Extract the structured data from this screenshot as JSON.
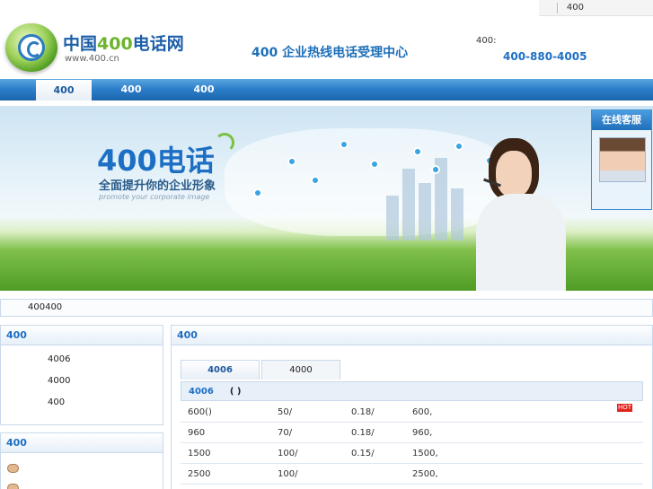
{
  "top_links": [
    "",
    "400",
    "",
    "",
    ""
  ],
  "header": {
    "logo_prefix": "中国",
    "logo_number": "400",
    "logo_suffix": "电话网",
    "logo_url": "www.400.cn",
    "slogan": "400 企业热线电话受理中心",
    "hotline_label": "400:",
    "hotline_number": "400-880-4005"
  },
  "nav": {
    "items": [
      "400",
      "400",
      "400"
    ],
    "active_index": 0
  },
  "banner": {
    "headline_number": "400",
    "headline_text": "电话",
    "sub": "全面提升你的企业形象",
    "en": "promote your corporate image"
  },
  "service": {
    "title": "在线客服"
  },
  "notice": "400400",
  "left_panel_1": {
    "title": "400",
    "items": [
      "4006",
      "4000",
      "400"
    ]
  },
  "left_panel_2": {
    "title": "400",
    "items": [
      "",
      ""
    ]
  },
  "main_panel": {
    "title": "400",
    "tabs": [
      "4006",
      "4000"
    ],
    "active_tab": 0,
    "table_head": "4006",
    "table_head_paren": "( )",
    "rows": [
      {
        "plan_num": "600",
        "plan_tag": "",
        "fee": "50/",
        "rate": "0.18/",
        "desc": "600,",
        "action": "",
        "hot": "HOT"
      },
      {
        "plan_num": "960",
        "plan_tag": "",
        "fee": "70/",
        "rate": "0.18/",
        "desc": "960,",
        "action": "",
        "hot": ""
      },
      {
        "plan_num": "1500",
        "plan_tag": "",
        "fee": "100/",
        "rate": "0.15/",
        "desc": "1500,",
        "action": "",
        "hot": ""
      },
      {
        "plan_num": "2500",
        "plan_tag": "",
        "fee": "100/",
        "rate": "",
        "desc": "2500,",
        "action": "",
        "hot": ""
      }
    ]
  },
  "colors": {
    "brand_blue": "#1d6fc4",
    "brand_green": "#6cb52c",
    "nav_blue": "#2a7cc8",
    "hot_red": "#e3221b"
  }
}
